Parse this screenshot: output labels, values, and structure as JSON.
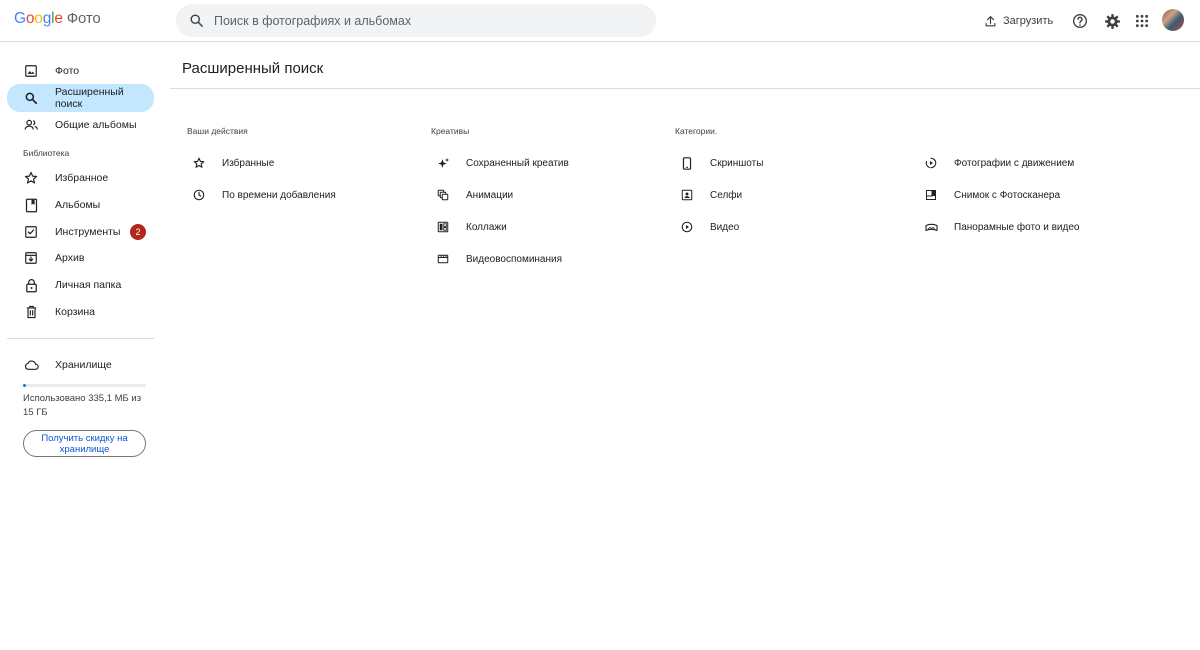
{
  "header": {
    "logo_letters": [
      "G",
      "o",
      "o",
      "g",
      "l",
      "e"
    ],
    "product": "Фото",
    "search_placeholder": "Поиск в фотографиях и альбомах",
    "upload_label": "Загрузить"
  },
  "sidebar": {
    "main_items": [
      {
        "label": "Фото",
        "icon": "photo-icon"
      },
      {
        "label": "Расширенный поиск",
        "icon": "search-icon",
        "active": true
      },
      {
        "label": "Общие альбомы",
        "icon": "people-icon"
      }
    ],
    "library_title": "Библиотека",
    "library_items": [
      {
        "label": "Избранное",
        "icon": "star-icon"
      },
      {
        "label": "Альбомы",
        "icon": "album-icon"
      },
      {
        "label": "Инструменты",
        "icon": "tools-icon",
        "badge": "2"
      },
      {
        "label": "Архив",
        "icon": "archive-icon"
      },
      {
        "label": "Личная папка",
        "icon": "lock-icon"
      },
      {
        "label": "Корзина",
        "icon": "trash-icon"
      }
    ],
    "storage": {
      "label": "Хранилище",
      "used_text": "Использовано 335,1 МБ из 15 ГБ",
      "used_fraction": 0.022,
      "cta": "Получить скидку на хранилище"
    }
  },
  "main": {
    "title": "Расширенный поиск",
    "columns": [
      {
        "heading": "Ваши действия",
        "items": [
          {
            "label": "Избранные",
            "icon": "star-icon"
          },
          {
            "label": "По времени добавления",
            "icon": "clock-icon"
          }
        ]
      },
      {
        "heading": "Креативы",
        "items": [
          {
            "label": "Сохраненный креатив",
            "icon": "sparkle-icon"
          },
          {
            "label": "Анимации",
            "icon": "animation-icon"
          },
          {
            "label": "Коллажи",
            "icon": "collage-icon"
          },
          {
            "label": "Видеовоспоминания",
            "icon": "movie-icon"
          }
        ]
      },
      {
        "heading": "Категории.",
        "items": [
          {
            "label": "Скриншоты",
            "icon": "phone-icon"
          },
          {
            "label": "Селфи",
            "icon": "selfie-icon"
          },
          {
            "label": "Видео",
            "icon": "play-icon"
          }
        ]
      },
      {
        "heading": "",
        "items": [
          {
            "label": "Фотографии с движением",
            "icon": "motion-icon"
          },
          {
            "label": "Снимок с Фотосканера",
            "icon": "photoscan-icon"
          },
          {
            "label": "Панорамные фото и видео",
            "icon": "panorama-icon"
          }
        ]
      }
    ]
  }
}
